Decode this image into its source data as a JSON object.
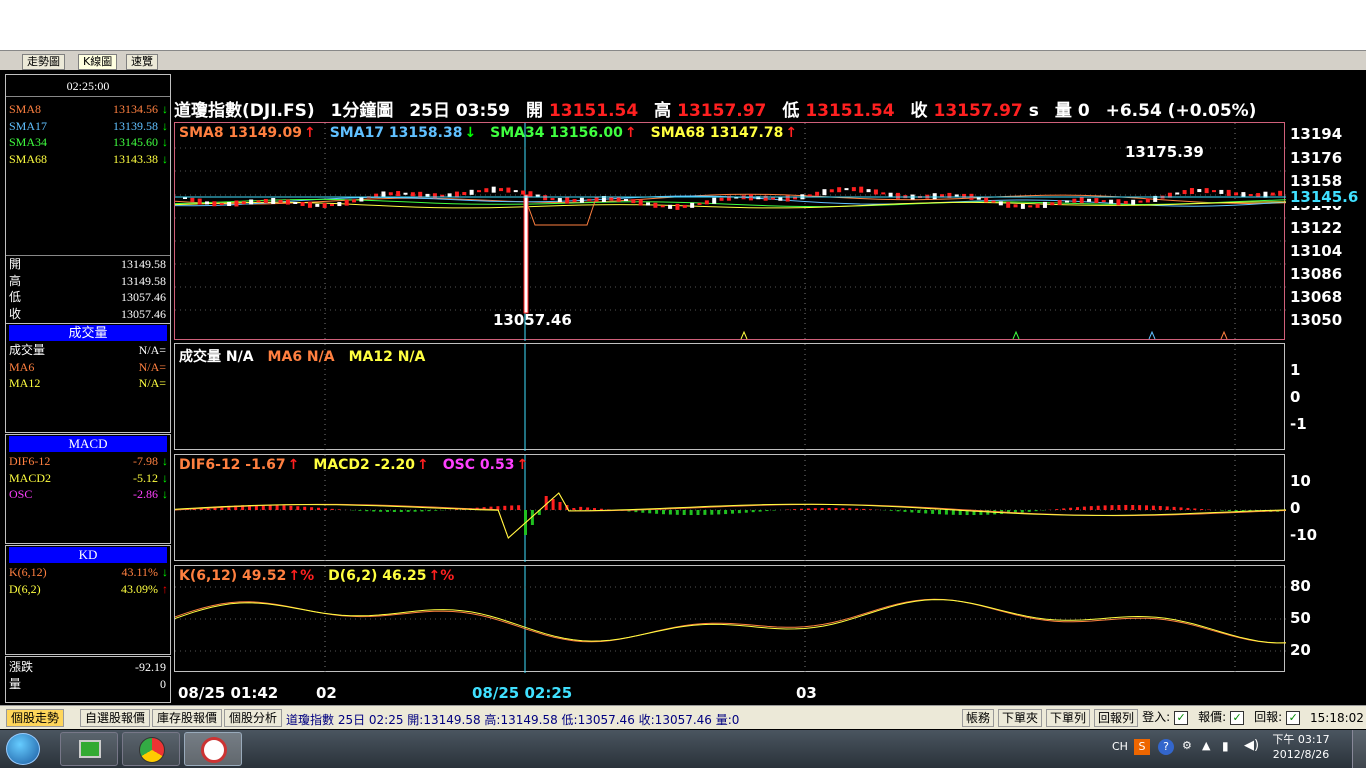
{
  "tabs": [
    "走勢圖",
    "K線圖",
    "速覽"
  ],
  "clock": "02:25:00",
  "header": {
    "name": "道瓊指數(DJI.FS)",
    "period": "1分鐘圖",
    "datetime": "25日 03:59",
    "open_label": "開",
    "open": "13151.54",
    "high_label": "高",
    "high": "13157.97",
    "low_label": "低",
    "low": "13151.54",
    "close_label": "收",
    "close": "13157.97",
    "suffix": "s",
    "vol_label": "量",
    "vol": "0",
    "change": "+6.54 (+0.05%)"
  },
  "left_sma": [
    {
      "name": "SMA8",
      "value": "13134.56",
      "arrow": "↓",
      "color": "#ff8040"
    },
    {
      "name": "SMA17",
      "value": "13139.58",
      "arrow": "↓",
      "color": "#60c0ff"
    },
    {
      "name": "SMA34",
      "value": "13145.60",
      "arrow": "↓",
      "color": "#40ff40"
    },
    {
      "name": "SMA68",
      "value": "13143.38",
      "arrow": "↓",
      "color": "#ffff40"
    }
  ],
  "left_ohlc": [
    {
      "label": "開",
      "value": "13149.58"
    },
    {
      "label": "高",
      "value": "13149.58"
    },
    {
      "label": "低",
      "value": "13057.46"
    },
    {
      "label": "收",
      "value": "13057.46"
    }
  ],
  "left_volume": {
    "title": "成交量",
    "rows": [
      {
        "label": "成交量",
        "value": "N/A="
      },
      {
        "label": "MA6",
        "value": "N/A="
      },
      {
        "label": "MA12",
        "value": "N/A="
      }
    ]
  },
  "left_macd": {
    "title": "MACD",
    "rows": [
      {
        "label": "DIF6-12",
        "value": "-7.98",
        "arrow": "↓"
      },
      {
        "label": "MACD2",
        "value": "-5.12",
        "arrow": "↓"
      },
      {
        "label": "OSC",
        "value": "-2.86",
        "arrow": "↓"
      }
    ]
  },
  "left_kd": {
    "title": "KD",
    "rows": [
      {
        "label": "K(6,12)",
        "value": "43.11%",
        "arrow": "↓"
      },
      {
        "label": "D(6,2)",
        "value": "43.09%",
        "arrow": "↑"
      }
    ]
  },
  "left_bottom": [
    {
      "label": "漲跌",
      "value": "-92.19"
    },
    {
      "label": "量",
      "value": "0"
    }
  ],
  "price_legend": [
    {
      "text": "SMA8 13149.09",
      "arrow": "↑",
      "color": "#ff8040"
    },
    {
      "text": "SMA17 13158.38",
      "arrow": "↓",
      "color": "#60c0ff"
    },
    {
      "text": "SMA34 13156.00",
      "arrow": "↑",
      "color": "#40ff40"
    },
    {
      "text": "SMA68 13147.78",
      "arrow": "↑",
      "color": "#ffff40"
    }
  ],
  "price_axis": [
    "13194",
    "13176",
    "13158",
    "13140",
    "13122",
    "13104",
    "13086",
    "13068",
    "13050"
  ],
  "price_current": "13145.6",
  "price_high_label": "13175.39",
  "price_low_label": "13057.46",
  "volume_legend": [
    {
      "text": "成交量 N/A",
      "color": "#ffffff"
    },
    {
      "text": "MA6 N/A",
      "color": "#ff8040"
    },
    {
      "text": "MA12 N/A",
      "color": "#ffff40"
    }
  ],
  "volume_axis": [
    "1",
    "0",
    "-1"
  ],
  "macd_legend": [
    {
      "text": "DIF6-12 -1.67",
      "arrow": "↑",
      "color": "#ff8040"
    },
    {
      "text": "MACD2 -2.20",
      "arrow": "↑",
      "color": "#ffff40"
    },
    {
      "text": "OSC 0.53",
      "arrow": "↑",
      "color": "#ff40ff"
    }
  ],
  "macd_axis": [
    "10",
    "0",
    "-10"
  ],
  "kd_legend": [
    {
      "text": "K(6,12) 49.52",
      "arrow": "↑%",
      "color": "#ff8040"
    },
    {
      "text": "D(6,2) 46.25",
      "arrow": "↑%",
      "color": "#ffff40"
    }
  ],
  "kd_axis": [
    "80",
    "50",
    "20"
  ],
  "xaxis": [
    "08/25 01:42",
    "02",
    "08/25 02:25",
    "03"
  ],
  "status_tabs": [
    "個股走勢",
    "自選股報價",
    "庫存股報價",
    "個股分析"
  ],
  "status_text": "道瓊指數 25日 02:25 開:13149.58 高:13149.58 低:13057.46 收:13057.46 量:0",
  "status_right": [
    "帳務",
    "下單夾",
    "下單列",
    "回報列",
    "登入:",
    "報價:",
    "回報:"
  ],
  "status_time": "15:18:02",
  "taskbar": {
    "lang": "CH",
    "time": "下午 03:17",
    "date": "2012/8/26"
  }
}
